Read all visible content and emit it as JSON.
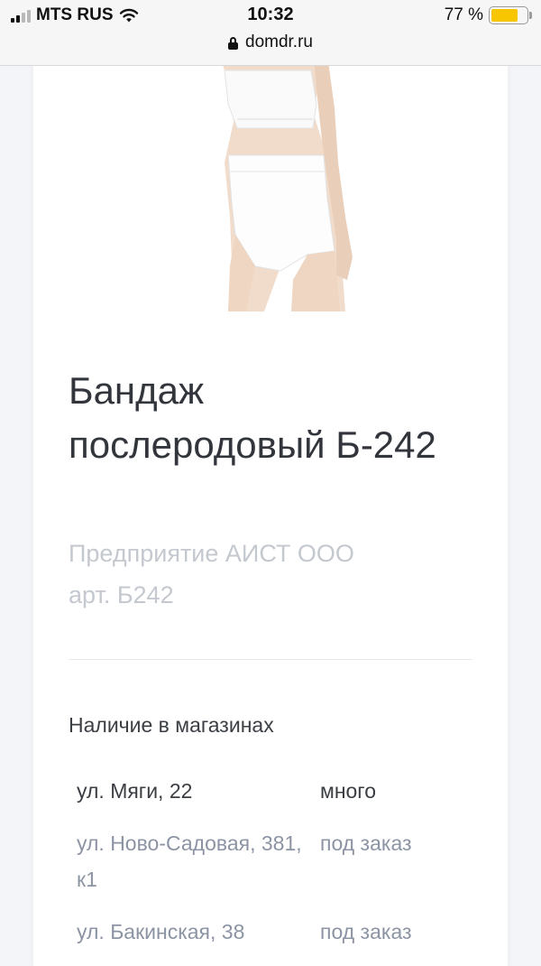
{
  "status_bar": {
    "carrier": "MTS RUS",
    "time": "10:32",
    "battery_percent": "77 %",
    "battery_level": 0.77,
    "battery_color": "#f7c600"
  },
  "browser": {
    "url": "domdr.ru",
    "lock_icon": "lock-icon"
  },
  "product": {
    "title": "Бандаж послеродовый Б-242",
    "manufacturer": "Предприятие АИСТ ООО",
    "article": "арт. Б242"
  },
  "availability": {
    "heading": "Наличие в магазинах",
    "stores": [
      {
        "address": "ул. Мяги, 22",
        "status": "много"
      },
      {
        "address": "ул. Ново-Садовая, 381, к1",
        "status": "под заказ"
      },
      {
        "address": "ул. Бакинская, 38",
        "status": "под заказ"
      }
    ]
  }
}
